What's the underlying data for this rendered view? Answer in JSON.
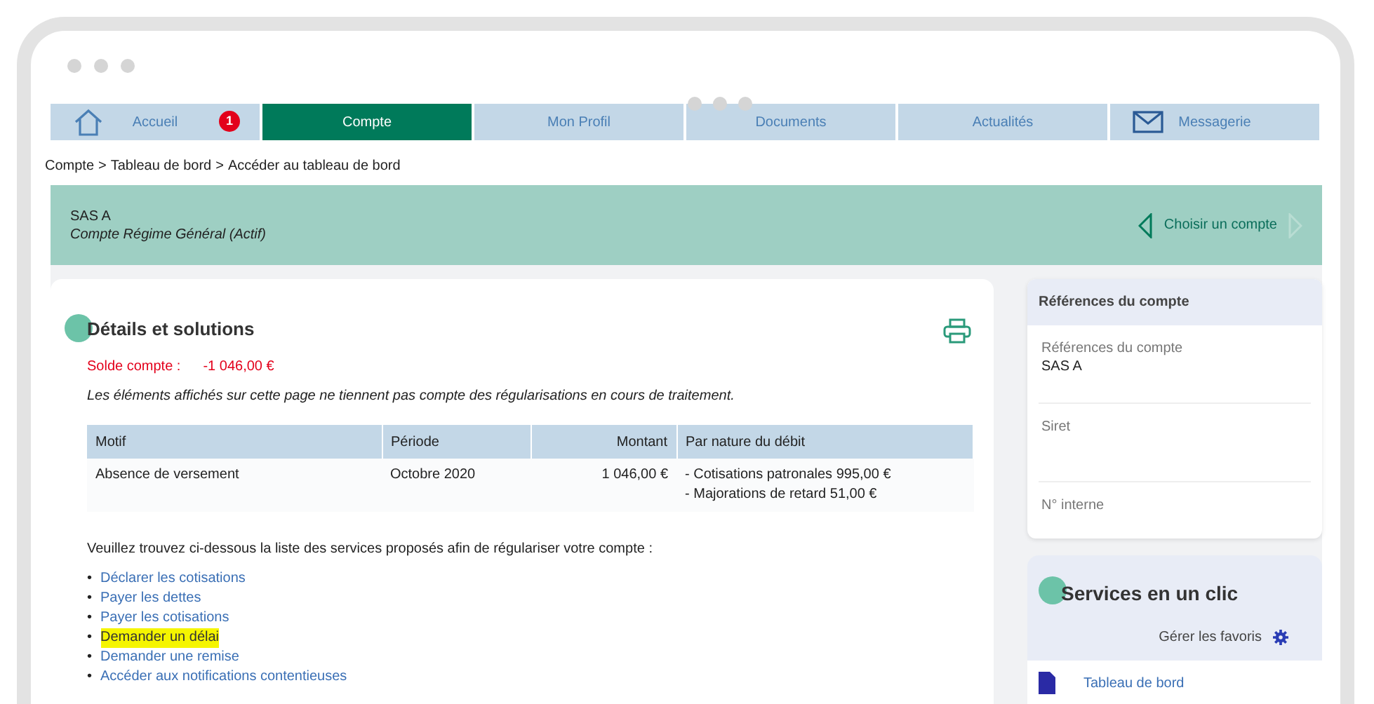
{
  "nav": {
    "tabs": [
      {
        "label": "Accueil",
        "kind": "home",
        "badge": "1",
        "selected": false
      },
      {
        "label": "Compte",
        "selected": true
      },
      {
        "label": "Mon Profil",
        "selected": false
      },
      {
        "label": "Documents",
        "selected": false
      },
      {
        "label": "Actualités",
        "selected": false
      },
      {
        "label": "Messagerie",
        "kind": "mail",
        "selected": false
      }
    ]
  },
  "breadcrumb": {
    "separator": ">",
    "items": [
      "Compte",
      "Tableau de bord",
      "Accéder au tableau de bord"
    ]
  },
  "account": {
    "name": "SAS A",
    "type": "Compte Régime Général (Actif)",
    "action": "Choisir un compte"
  },
  "details": {
    "title": "Détails et solutions",
    "balance_label": "Solde compte :",
    "balance_value": "-1 046,00 €",
    "note": "Les éléments affichés sur cette page ne tiennent pas compte des régularisations en cours de traitement.",
    "table": {
      "columns": [
        "Motif",
        "Période",
        "Montant",
        "Par nature du débit"
      ],
      "rows": [
        {
          "motif": "Absence de versement",
          "periode": "Octobre 2020",
          "montant": "1 046,00 €",
          "nature": [
            "- Cotisations patronales 995,00 €",
            "- Majorations de retard 51,00 €"
          ]
        }
      ]
    },
    "intro": "Veuillez trouvez ci-dessous la liste des services proposés afin de régulariser votre compte :",
    "bullet": "•",
    "services": [
      {
        "label": "Déclarer les cotisations",
        "highlighted": false
      },
      {
        "label": "Payer les dettes",
        "highlighted": false
      },
      {
        "label": "Payer les cotisations",
        "highlighted": false
      },
      {
        "label": "Demander un délai",
        "highlighted": true
      },
      {
        "label": "Demander une remise",
        "highlighted": false
      },
      {
        "label": "Accéder aux notifications contentieuses",
        "highlighted": false
      }
    ]
  },
  "references": {
    "title": "Références du compte",
    "fields": [
      {
        "label": "Références du compte",
        "value": "SAS A"
      },
      {
        "label": "Siret"
      },
      {
        "label": "N° interne"
      }
    ]
  },
  "quick_services": {
    "title": "Services en un clic",
    "manage": "Gérer les favoris",
    "items": [
      {
        "label": "Tableau de bord"
      }
    ]
  }
}
